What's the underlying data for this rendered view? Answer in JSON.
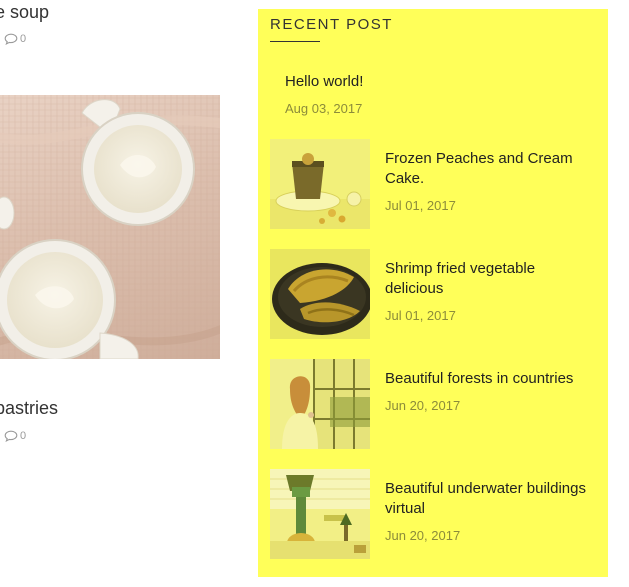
{
  "left_posts": [
    {
      "title": "e soup",
      "comments": "0"
    },
    {
      "title": "pastries",
      "comments": "0"
    }
  ],
  "sidebar": {
    "widget_title": "Recent Post",
    "posts": [
      {
        "title": "Hello world!",
        "date": "Aug 03, 2017"
      },
      {
        "title": "Frozen Peaches and Cream Cake.",
        "date": "Jul 01, 2017"
      },
      {
        "title": "Shrimp fried vegetable delicious",
        "date": "Jul 01, 2017"
      },
      {
        "title": "Beautiful forests in countries",
        "date": "Jun 20, 2017"
      },
      {
        "title": "Beautiful underwater buildings virtual",
        "date": "Jun 20, 2017"
      }
    ]
  },
  "colors": {
    "sidebar_bg": "#ffff59",
    "date_text": "#8c8c3a",
    "title_text": "#222222"
  },
  "icons": [
    "comment-icon"
  ]
}
